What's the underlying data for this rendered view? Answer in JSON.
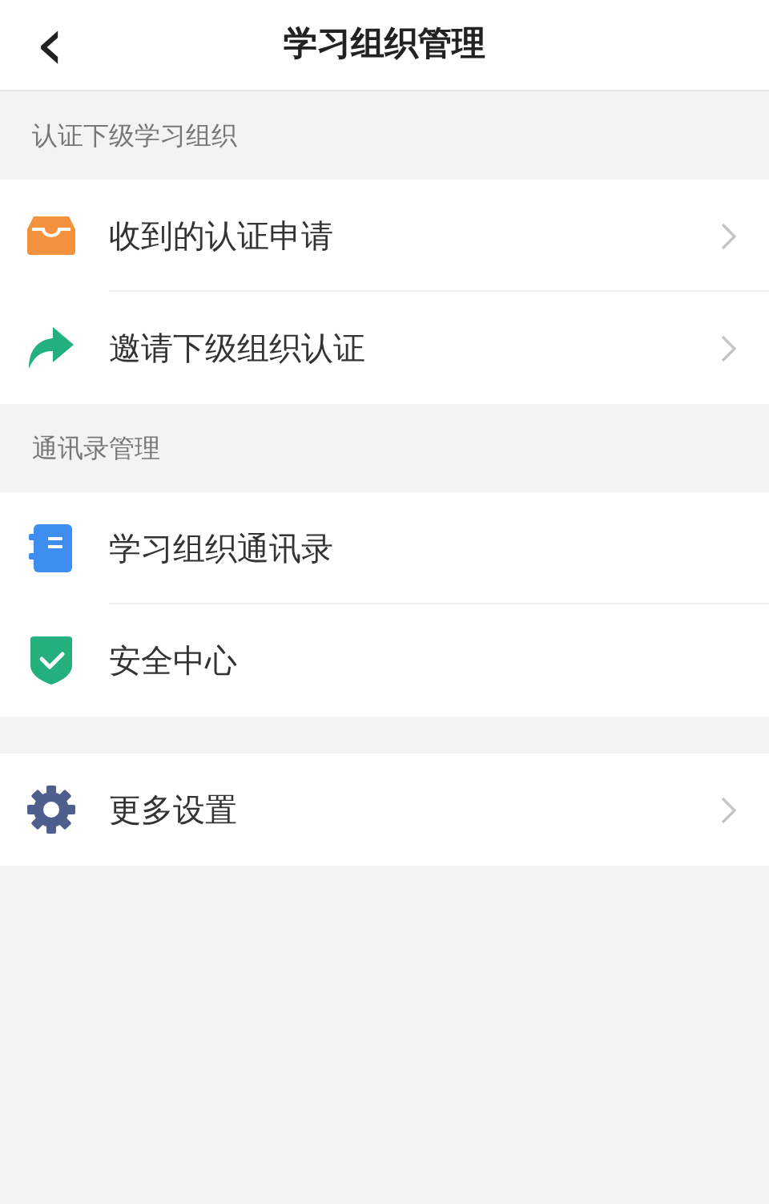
{
  "header": {
    "back_icon": "‹",
    "title": "学习组织管理"
  },
  "groups": [
    {
      "title": "认证下级学习组织",
      "items": [
        {
          "kind": "inbox",
          "label": "收到的认证申请",
          "chevron": true
        },
        {
          "kind": "share",
          "label": "邀请下级组织认证",
          "chevron": true
        }
      ]
    },
    {
      "title": "通讯录管理",
      "items": [
        {
          "kind": "book",
          "label": "学习组织通讯录",
          "chevron": false
        },
        {
          "kind": "shield",
          "label": "安全中心",
          "chevron": false
        }
      ]
    },
    {
      "items": [
        {
          "kind": "gear",
          "label": "更多设置",
          "chevron": true
        }
      ]
    }
  ]
}
